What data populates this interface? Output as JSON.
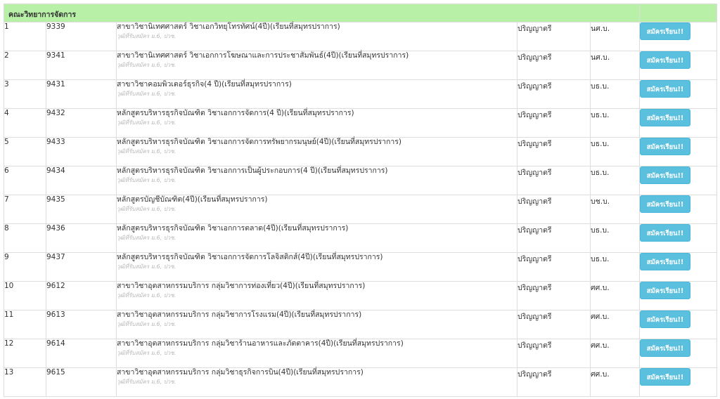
{
  "faculty": {
    "name": "คณะวิทยาการจัดการ"
  },
  "qualification_note": "วุฒิที่รับสมัคร ม.6, ปวช.",
  "apply_label": "สมัครเรียน!!",
  "colors": {
    "section_bg": "#b8f0a8",
    "button_bg": "#5bc0de",
    "border": "#dddddd"
  },
  "programs": [
    {
      "no": "1",
      "code": "9339",
      "name": "สาขาวิชานิเทศศาสตร์ วิชาเอกวิทยุโทรทัศน์(4ปี)(เรียนที่สมุทรปราการ)",
      "degree": "ปริญญาตรี",
      "abbr": "นศ.บ."
    },
    {
      "no": "2",
      "code": "9341",
      "name": "สาขาวิชานิเทศศาสตร์ วิชาเอกการโฆษณาและการประชาสัมพันธ์(4ปี)(เรียนที่สมุทรปราการ)",
      "degree": "ปริญญาตรี",
      "abbr": "นศ.บ."
    },
    {
      "no": "3",
      "code": "9431",
      "name": "สาขาวิชาคอมพิวเตอร์ธุรกิจ(4 ปี)(เรียนที่สมุทรปราการ)",
      "degree": "ปริญญาตรี",
      "abbr": "บธ.บ."
    },
    {
      "no": "4",
      "code": "9432",
      "name": "หลักสูตรบริหารธุรกิจบัณฑิต วิชาเอกการจัดการ(4 ปี)(เรียนที่สมุทรปราการ)",
      "degree": "ปริญญาตรี",
      "abbr": "บธ.บ."
    },
    {
      "no": "5",
      "code": "9433",
      "name": "หลักสูตรบริหารธุรกิจบัณฑิต วิชาเอกการจัดการทรัพยากรมนุษย์(4ปี)(เรียนที่สมุทรปราการ)",
      "degree": "ปริญญาตรี",
      "abbr": "บธ.บ."
    },
    {
      "no": "6",
      "code": "9434",
      "name": "หลักสูตรบริหารธุรกิจบัณฑิต วิชาเอกการเป็นผู้ประกอบการ(4 ปี)(เรียนที่สมุทรปราการ)",
      "degree": "ปริญญาตรี",
      "abbr": "บธ.บ."
    },
    {
      "no": "7",
      "code": "9435",
      "name": "หลักสูตรบัญชีบัณฑิต(4ปี)(เรียนที่สมุทรปราการ)",
      "degree": "ปริญญาตรี",
      "abbr": "บช.บ."
    },
    {
      "no": "8",
      "code": "9436",
      "name": "หลักสูตรบริหารธุรกิจบัณฑิต วิชาเอกการตลาด(4ปี)(เรียนที่สมุทรปราการ)",
      "degree": "ปริญญาตรี",
      "abbr": "บธ.บ."
    },
    {
      "no": "9",
      "code": "9437",
      "name": "หลักสูตรบริหารธุรกิจบัณฑิต วิชาเอกการจัดการโลจิสติกส์(4ปี)(เรียนที่สมุทรปราการ)",
      "degree": "ปริญญาตรี",
      "abbr": "บธ.บ."
    },
    {
      "no": "10",
      "code": "9612",
      "name": "สาขาวิชาอุตสาหกรรมบริการ กลุ่มวิชาการท่องเที่ยว(4ปี)(เรียนที่สมุทรปราการ)",
      "degree": "ปริญญาตรี",
      "abbr": "ศศ.บ."
    },
    {
      "no": "11",
      "code": "9613",
      "name": "สาขาวิชาอุตสาหกรรมบริการ กลุ่มวิชาการโรงแรม(4ปี)(เรียนที่สมุทรปราการ)",
      "degree": "ปริญญาตรี",
      "abbr": "ศศ.บ."
    },
    {
      "no": "12",
      "code": "9614",
      "name": "สาขาวิชาอุตสาหกรรมบริการ กลุ่มวิชาร้านอาหารและภัตตาคาร(4ปี)(เรียนที่สมุทรปราการ)",
      "degree": "ปริญญาตรี",
      "abbr": "ศศ.บ."
    },
    {
      "no": "13",
      "code": "9615",
      "name": "สาขาวิชาอุตสาหกรรมบริการ กลุ่มวิชาธุรกิจการบิน(4ปี)(เรียนที่สมุทรปราการ)",
      "degree": "ปริญญาตรี",
      "abbr": "ศศ.บ."
    }
  ]
}
